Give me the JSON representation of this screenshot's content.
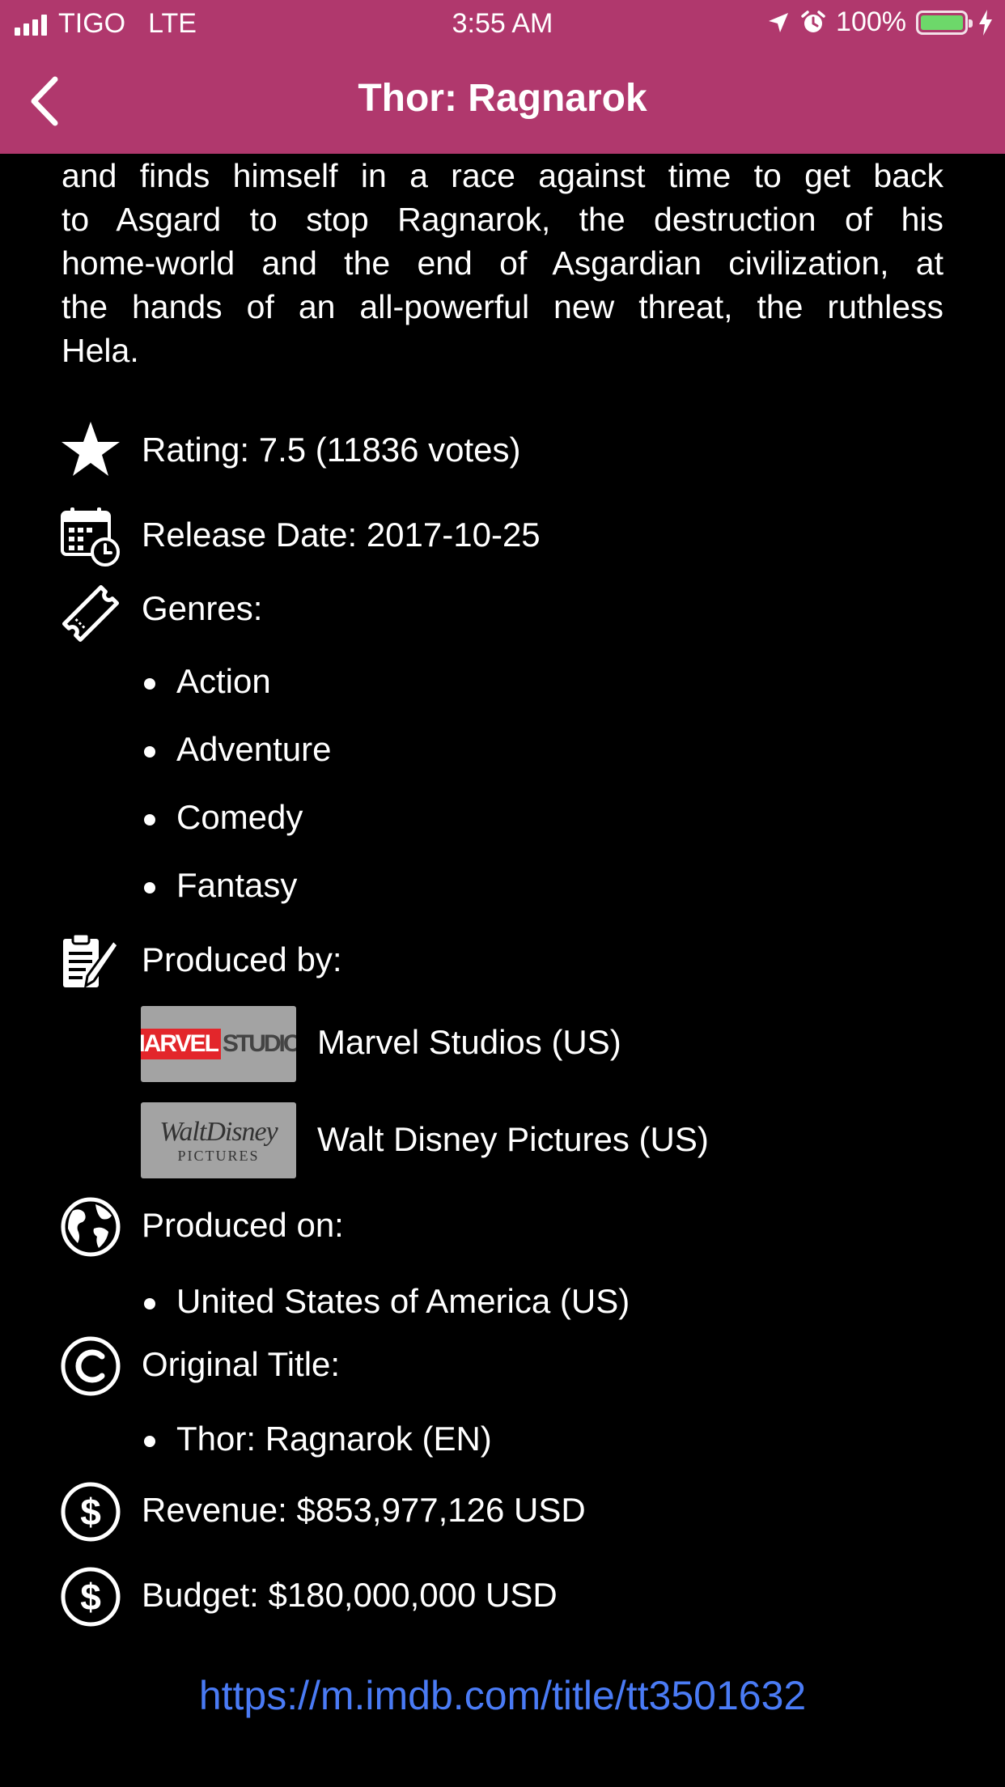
{
  "status_bar": {
    "carrier": "TIGO",
    "network": "LTE",
    "time": "3:55 AM",
    "battery": "100%",
    "battery_level": 1.0
  },
  "nav": {
    "title": "Thor: Ragnarok",
    "back_icon": "chevron-left-icon"
  },
  "synopsis_lines": [
    "and finds himself in a race against time to get back",
    "to Asgard to stop Ragnarok, the destruction of his",
    "home-world and the end of Asgardian civilization, at",
    "the hands of an all-powerful new threat, the ruthless",
    "Hela."
  ],
  "rating": {
    "icon": "star-icon",
    "text": "Rating: 7.5  (11836 votes)"
  },
  "release": {
    "icon": "calendar-icon",
    "text": "Release Date: 2017-10-25"
  },
  "genres": {
    "icon": "ticket-icon",
    "label": "Genres:",
    "items": [
      "Action",
      "Adventure",
      "Comedy",
      "Fantasy"
    ]
  },
  "producers": {
    "icon": "clipboard-icon",
    "label": "Produced by:",
    "companies": [
      {
        "name": "Marvel Studios (US)",
        "logo_text_a": "MARVEL",
        "logo_text_b": "STUDIOS"
      },
      {
        "name": "Walt Disney Pictures (US)",
        "logo_text_a": "WaltDisney",
        "logo_text_b": "PICTURES"
      }
    ]
  },
  "countries": {
    "icon": "globe-icon",
    "label": "Produced on:",
    "items": [
      "United States of America (US)"
    ]
  },
  "original_title": {
    "icon": "copyright-icon",
    "label": "Original Title:",
    "items": [
      "Thor: Ragnarok (EN)"
    ]
  },
  "revenue": {
    "icon": "dollar-icon",
    "text": "Revenue: $853,977,126 USD"
  },
  "budget": {
    "icon": "dollar-icon",
    "text": "Budget: $180,000,000 USD"
  },
  "imdb_link": "https://m.imdb.com/title/tt3501632",
  "colors": {
    "header": "#b0386d",
    "background": "#000000",
    "link": "#4a7bf5",
    "battery": "#6dd86a"
  }
}
